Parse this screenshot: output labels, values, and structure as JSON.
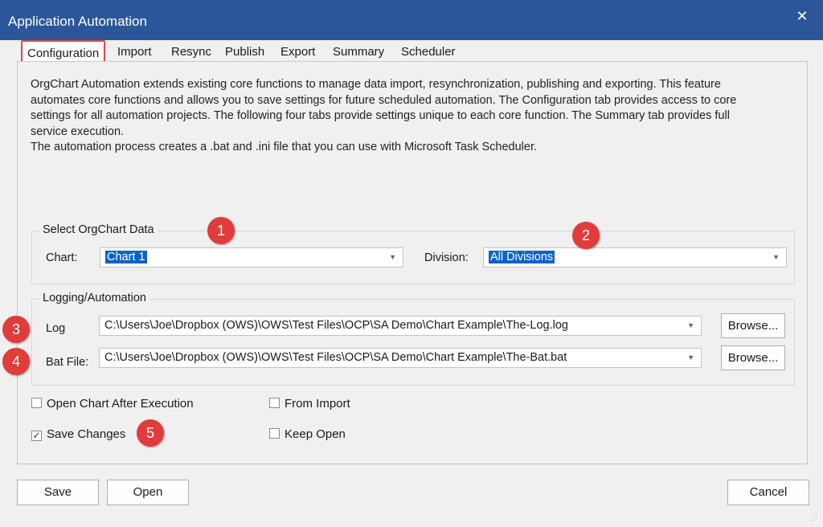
{
  "window": {
    "title": "Application Automation",
    "close_glyph": "✕"
  },
  "tabs": [
    {
      "label": "Configuration"
    },
    {
      "label": "Import"
    },
    {
      "label": "Resync"
    },
    {
      "label": "Publish"
    },
    {
      "label": "Export"
    },
    {
      "label": "Summary"
    },
    {
      "label": "Scheduler"
    }
  ],
  "description": {
    "line1": "OrgChart Automation extends existing core functions to manage data import, resynchronization, publishing and exporting. This feature",
    "line2": "automates core functions and allows you to save settings for future scheduled automation. The Configuration tab provides access to core",
    "line3": "settings for all automation projects.  The following four tabs provide settings unique to each core function. The Summary tab provides full",
    "line4": "service execution.",
    "line5": "The automation process creates a .bat and .ini file that you can use with Microsoft Task Scheduler."
  },
  "select_data": {
    "title": "Select OrgChart Data",
    "chart_label": "Chart:",
    "chart_value": "Chart 1",
    "division_label": "Division:",
    "division_value": "All Divisions"
  },
  "logging": {
    "title": "Logging/Automation",
    "log_label": "Log",
    "log_value": "C:\\Users\\Joe\\Dropbox (OWS)\\OWS\\Test Files\\OCP\\SA Demo\\Chart Example\\The-Log.log",
    "bat_label": "Bat File:",
    "bat_value": "C:\\Users\\Joe\\Dropbox (OWS)\\OWS\\Test Files\\OCP\\SA Demo\\Chart Example\\The-Bat.bat",
    "browse_label": "Browse..."
  },
  "options": {
    "open_chart": {
      "label": "Open Chart After Execution",
      "checked": false
    },
    "from_import": {
      "label": "From Import",
      "checked": false
    },
    "save_changes": {
      "label": "Save Changes",
      "checked": true
    },
    "keep_open": {
      "label": "Keep Open",
      "checked": false
    }
  },
  "buttons": {
    "save": "Save",
    "open": "Open",
    "cancel": "Cancel"
  },
  "markers": [
    "1",
    "2",
    "3",
    "4",
    "5"
  ],
  "colors": {
    "titlebar": "#2b579a",
    "marker": "#e03c3c",
    "selection": "#0a64c8",
    "active_tab_border": "#e0474c"
  }
}
